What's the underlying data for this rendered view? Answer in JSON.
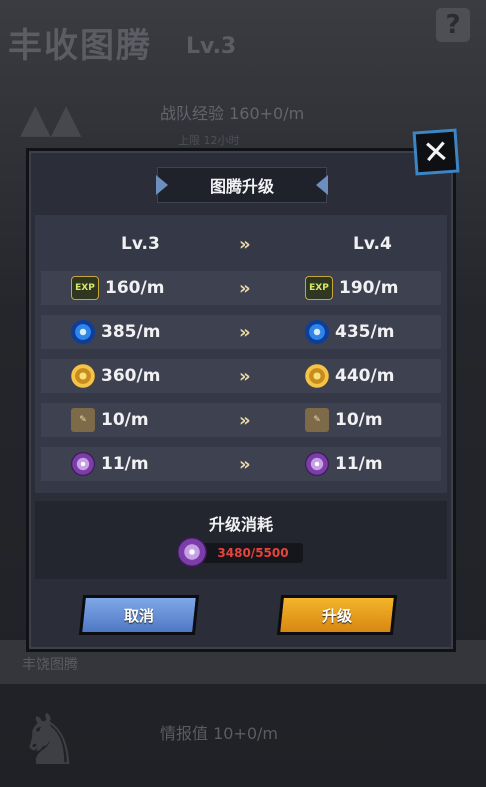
{
  "background": {
    "title": "丰收图腾",
    "level": "Lv.3",
    "help_icon": "question-mark-icon",
    "stat_top": "战队经验 160+0/m",
    "stat_top_sub": "上限 12小时",
    "section_label": "丰饶图腾",
    "stat_bottom": "情报值 10+0/m"
  },
  "modal": {
    "title": "图腾升级",
    "close_icon": "close-icon",
    "rows": [
      {
        "icon": "",
        "left": "Lv.3",
        "right": "Lv.4"
      },
      {
        "icon": "exp-icon",
        "icon_text": "EXP",
        "left": "160/m",
        "right": "190/m"
      },
      {
        "icon": "blue-orb-icon",
        "left": "385/m",
        "right": "435/m"
      },
      {
        "icon": "gold-coin-icon",
        "left": "360/m",
        "right": "440/m"
      },
      {
        "icon": "scroll-quill-icon",
        "left": "10/m",
        "right": "10/m"
      },
      {
        "icon": "purple-swirl-icon",
        "left": "11/m",
        "right": "11/m"
      }
    ],
    "arrow": "»",
    "cost": {
      "title": "升级消耗",
      "icon": "purple-swirl-icon",
      "amount": "3480/5500"
    },
    "buttons": {
      "cancel": "取消",
      "upgrade": "升级"
    }
  },
  "colors": {
    "cancel_button": "#5f88d6",
    "upgrade_button": "#e99c1c",
    "cost_shortfall": "#e8433c",
    "close_border": "#3d86c6"
  }
}
